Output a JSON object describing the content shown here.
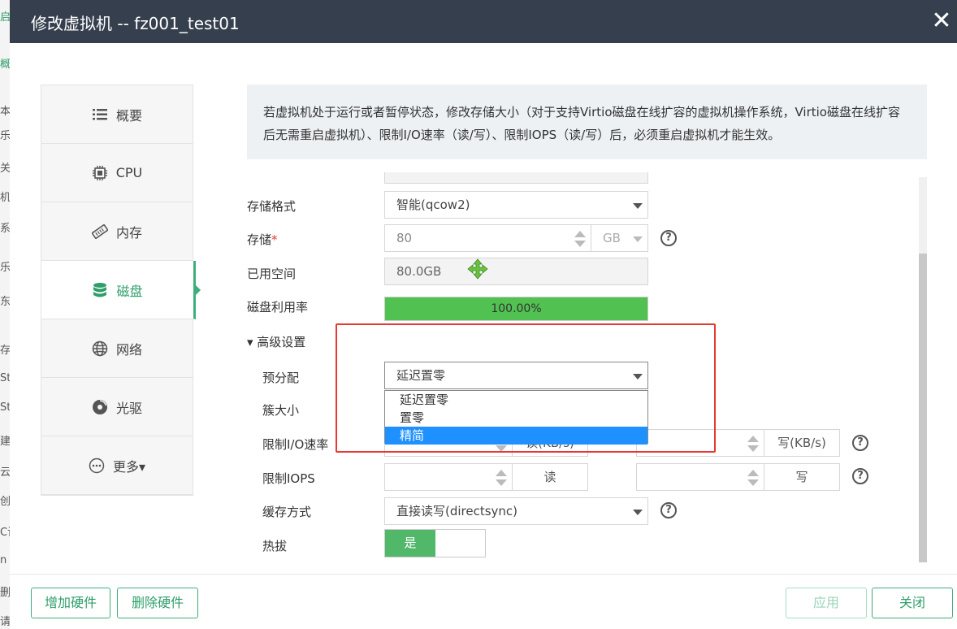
{
  "background": {
    "fragments": [
      "启",
      "概",
      "本",
      "乐",
      "关",
      "机",
      "系",
      "乐",
      "东",
      "存",
      "Sto",
      "Sto",
      "建",
      "云",
      "创",
      "C诶",
      "n",
      "删",
      "请"
    ]
  },
  "dialog": {
    "title": "修改虚拟机 -- fz001_test01",
    "close_symbol": "✕"
  },
  "sidebar": {
    "items": [
      {
        "label": "概要",
        "icon": "list-icon"
      },
      {
        "label": "CPU",
        "icon": "cpu-icon"
      },
      {
        "label": "内存",
        "icon": "memory-icon"
      },
      {
        "label": "磁盘",
        "icon": "disk-icon"
      },
      {
        "label": "网络",
        "icon": "globe-icon"
      },
      {
        "label": "光驱",
        "icon": "cd-icon"
      },
      {
        "label": "更多▾",
        "icon": "more-icon"
      }
    ],
    "active_index": 3
  },
  "notice": {
    "text": "若虚拟机处于运行或者暂停状态，修改存储大小（对于支持Virtio磁盘在线扩容的虚拟机操作系统，Virtio磁盘在线扩容后无需重启虚拟机）、限制I/O速率（读/写）、限制IOPS（读/写）后，必须重启虚拟机才能生效。"
  },
  "form": {
    "storage_format": {
      "label": "存储格式",
      "value": "智能(qcow2)"
    },
    "storage": {
      "label": "存储",
      "required_mark": "*",
      "value": "80",
      "unit": "GB"
    },
    "used_space": {
      "label": "已用空间",
      "value": "80.0GB"
    },
    "disk_usage": {
      "label": "磁盘利用率",
      "value": "100.00%",
      "percent": 100
    },
    "advanced": {
      "label": "▾ 高级设置"
    },
    "preallocation": {
      "label": "预分配",
      "value": "延迟置零",
      "options": [
        "延迟置零",
        "置零",
        "精简"
      ],
      "highlighted_index": 2
    },
    "cluster_size": {
      "label": "簇大小"
    },
    "io_rate": {
      "label": "限制I/O速率",
      "read_unit": "读(KB/s)",
      "write_unit": "写(KB/s)"
    },
    "iops": {
      "label": "限制IOPS",
      "read_unit": "读",
      "write_unit": "写"
    },
    "cache_mode": {
      "label": "缓存方式",
      "value": "直接读写(directsync)"
    },
    "hot_plug": {
      "label": "热拔",
      "value": "是"
    }
  },
  "footer": {
    "add_hardware": "增加硬件",
    "remove_hardware": "删除硬件",
    "apply": "应用",
    "close": "关闭"
  },
  "colors": {
    "titlebar": "#353f4d",
    "accent": "#3fae7d",
    "progress": "#51c251",
    "highlight": "#1e90ff",
    "annotation": "#e53935"
  }
}
